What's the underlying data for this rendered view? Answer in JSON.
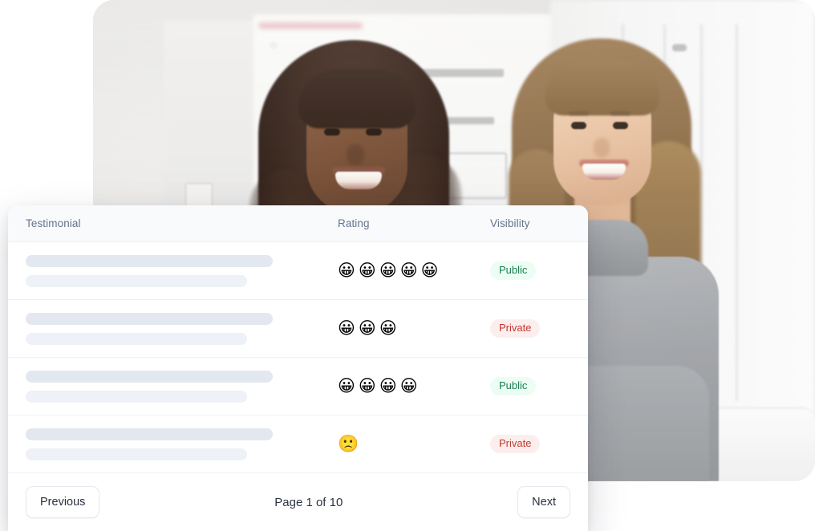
{
  "photo": {
    "alt": "two smiling businesswomen in a bright office with a whiteboard",
    "caption": ""
  },
  "table": {
    "columns": [
      {
        "key": "testimonial",
        "label": "Testimonial"
      },
      {
        "key": "rating",
        "label": "Rating"
      },
      {
        "key": "visibility",
        "label": "Visibility"
      }
    ],
    "rows": [
      {
        "testimonial_placeholder": true,
        "rating_count": 5,
        "rating_emoji": "grinning-face",
        "visibility": "Public"
      },
      {
        "testimonial_placeholder": true,
        "rating_count": 3,
        "rating_emoji": "grinning-face",
        "visibility": "Private"
      },
      {
        "testimonial_placeholder": true,
        "rating_count": 4,
        "rating_emoji": "grinning-face",
        "visibility": "Public"
      },
      {
        "testimonial_placeholder": true,
        "rating_count": 1,
        "rating_emoji": "frowning-face",
        "visibility": "Private"
      }
    ]
  },
  "pagination": {
    "previous_label": "Previous",
    "next_label": "Next",
    "page_info": "Page 1 of 10",
    "current_page": 1,
    "total_pages": 10
  },
  "colors": {
    "public_badge_bg": "#ecfdf3",
    "public_badge_text": "#1a7f51",
    "private_badge_bg": "#fdeeee",
    "private_badge_text": "#c0392f",
    "header_bg": "#f8fafc",
    "header_text": "#64748b",
    "skeleton_dark": "#e3e7ef",
    "skeleton_light": "#eef1f7"
  },
  "glyphs": {
    "grinning-face": "😀",
    "frowning-face": "🙁"
  }
}
